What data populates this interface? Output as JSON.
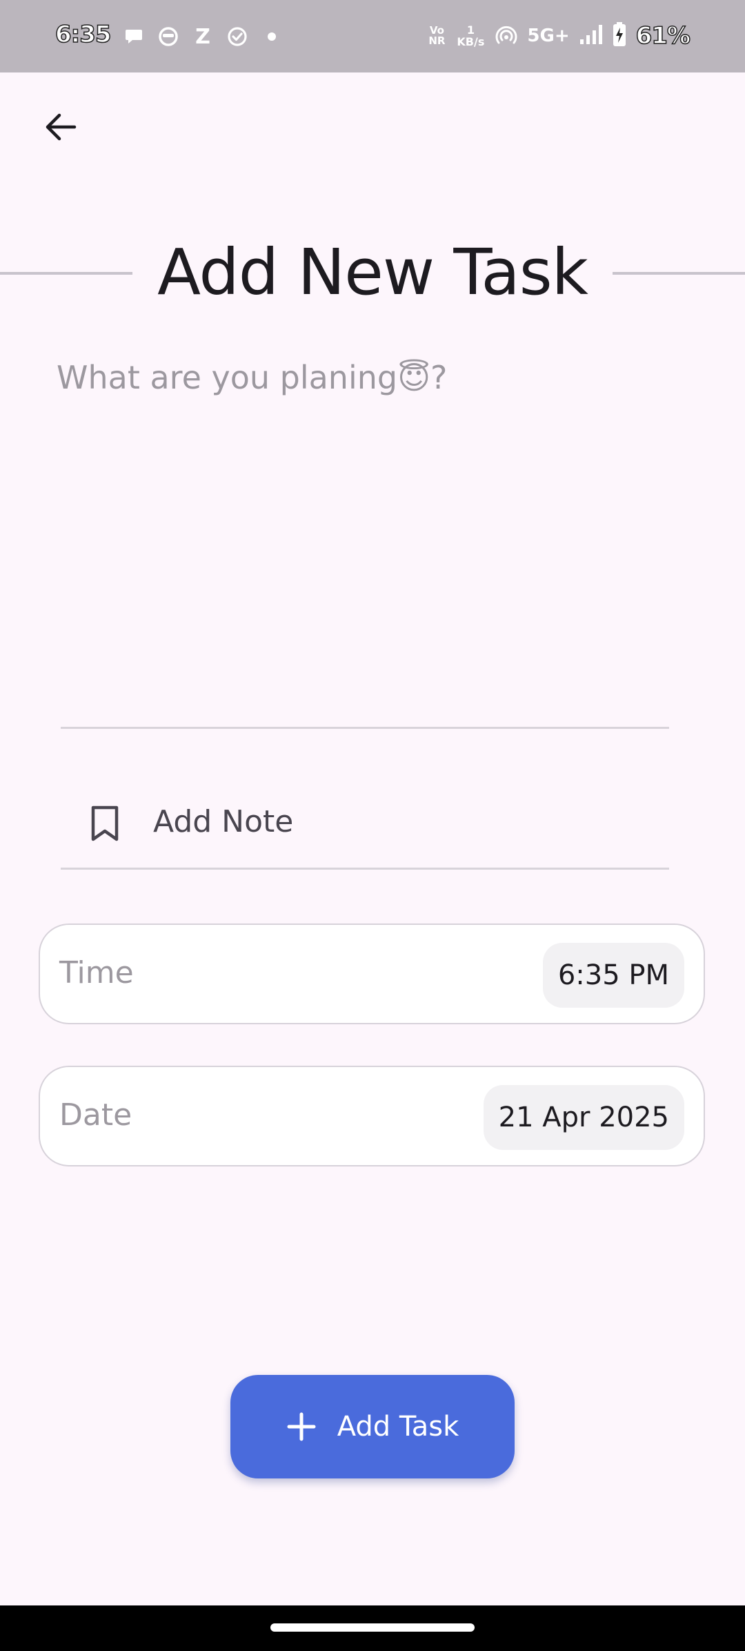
{
  "status_bar": {
    "time": "6:35",
    "vonr": "Vo\nNR",
    "net_speed": "1\nKB/s",
    "network": "5G+",
    "battery": "61%",
    "left_icons": [
      "chat-bubble-icon",
      "helmet-icon",
      "z-app-icon",
      "check-circle-icon",
      "dot-icon"
    ],
    "z_glyph": "Z"
  },
  "header": {
    "back_icon": "arrow-left-icon",
    "title": "Add New Task"
  },
  "task": {
    "placeholder": "What are you planing😇?",
    "value": ""
  },
  "note": {
    "icon": "bookmark-icon",
    "placeholder": "Add Note",
    "value": ""
  },
  "time_field": {
    "label": "Time",
    "value": "6:35 PM"
  },
  "date_field": {
    "label": "Date",
    "value": "21 Apr 2025"
  },
  "add_task_button": {
    "icon": "plus-icon",
    "label": "Add Task"
  },
  "colors": {
    "background": "#fdf6fc",
    "status_bar": "#bbb6bd",
    "accent": "#4a6bdc",
    "title_text": "#1d1b20",
    "placeholder_text": "#9c989f"
  }
}
